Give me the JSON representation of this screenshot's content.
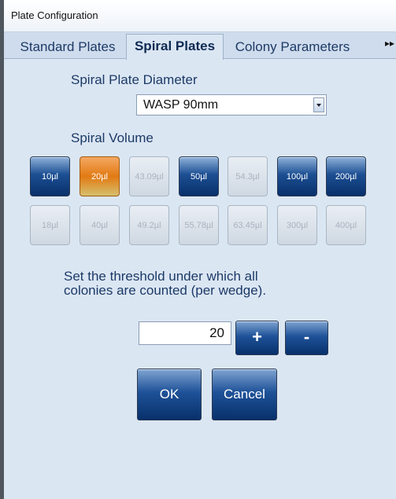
{
  "window": {
    "title": "Plate Configuration"
  },
  "tabs": [
    {
      "label": "Standard Plates"
    },
    {
      "label": "Spiral Plates"
    },
    {
      "label": "Colony Parameters"
    }
  ],
  "tab_scroll_arrow": "▸▸",
  "diameter": {
    "label": "Spiral Plate Diameter",
    "selected": "WASP 90mm"
  },
  "volume": {
    "label": "Spiral Volume",
    "row1": [
      {
        "label": "10µl",
        "state": "on"
      },
      {
        "label": "20µl",
        "state": "selected"
      },
      {
        "label": "43.09µl",
        "state": "off"
      },
      {
        "label": "50µl",
        "state": "on"
      },
      {
        "label": "54.3µl",
        "state": "off"
      },
      {
        "label": "100µl",
        "state": "on"
      },
      {
        "label": "200µl",
        "state": "on"
      }
    ],
    "row2": [
      {
        "label": "18µl",
        "state": "off"
      },
      {
        "label": "40µl",
        "state": "off"
      },
      {
        "label": "49.2µl",
        "state": "off"
      },
      {
        "label": "55.78µl",
        "state": "off"
      },
      {
        "label": "63.45µl",
        "state": "off"
      },
      {
        "label": "300µl",
        "state": "off"
      },
      {
        "label": "400µl",
        "state": "off"
      }
    ]
  },
  "threshold": {
    "instruction_line1": "Set the threshold under which all",
    "instruction_line2": "colonies are counted (per wedge).",
    "value": "20",
    "plus_label": "+",
    "minus_label": "-"
  },
  "actions": {
    "ok_label": "OK",
    "cancel_label": "Cancel"
  },
  "colors": {
    "button_blue": "#1f5299",
    "button_selected": "#e27a12",
    "panel_bg": "#dbe6f3"
  }
}
